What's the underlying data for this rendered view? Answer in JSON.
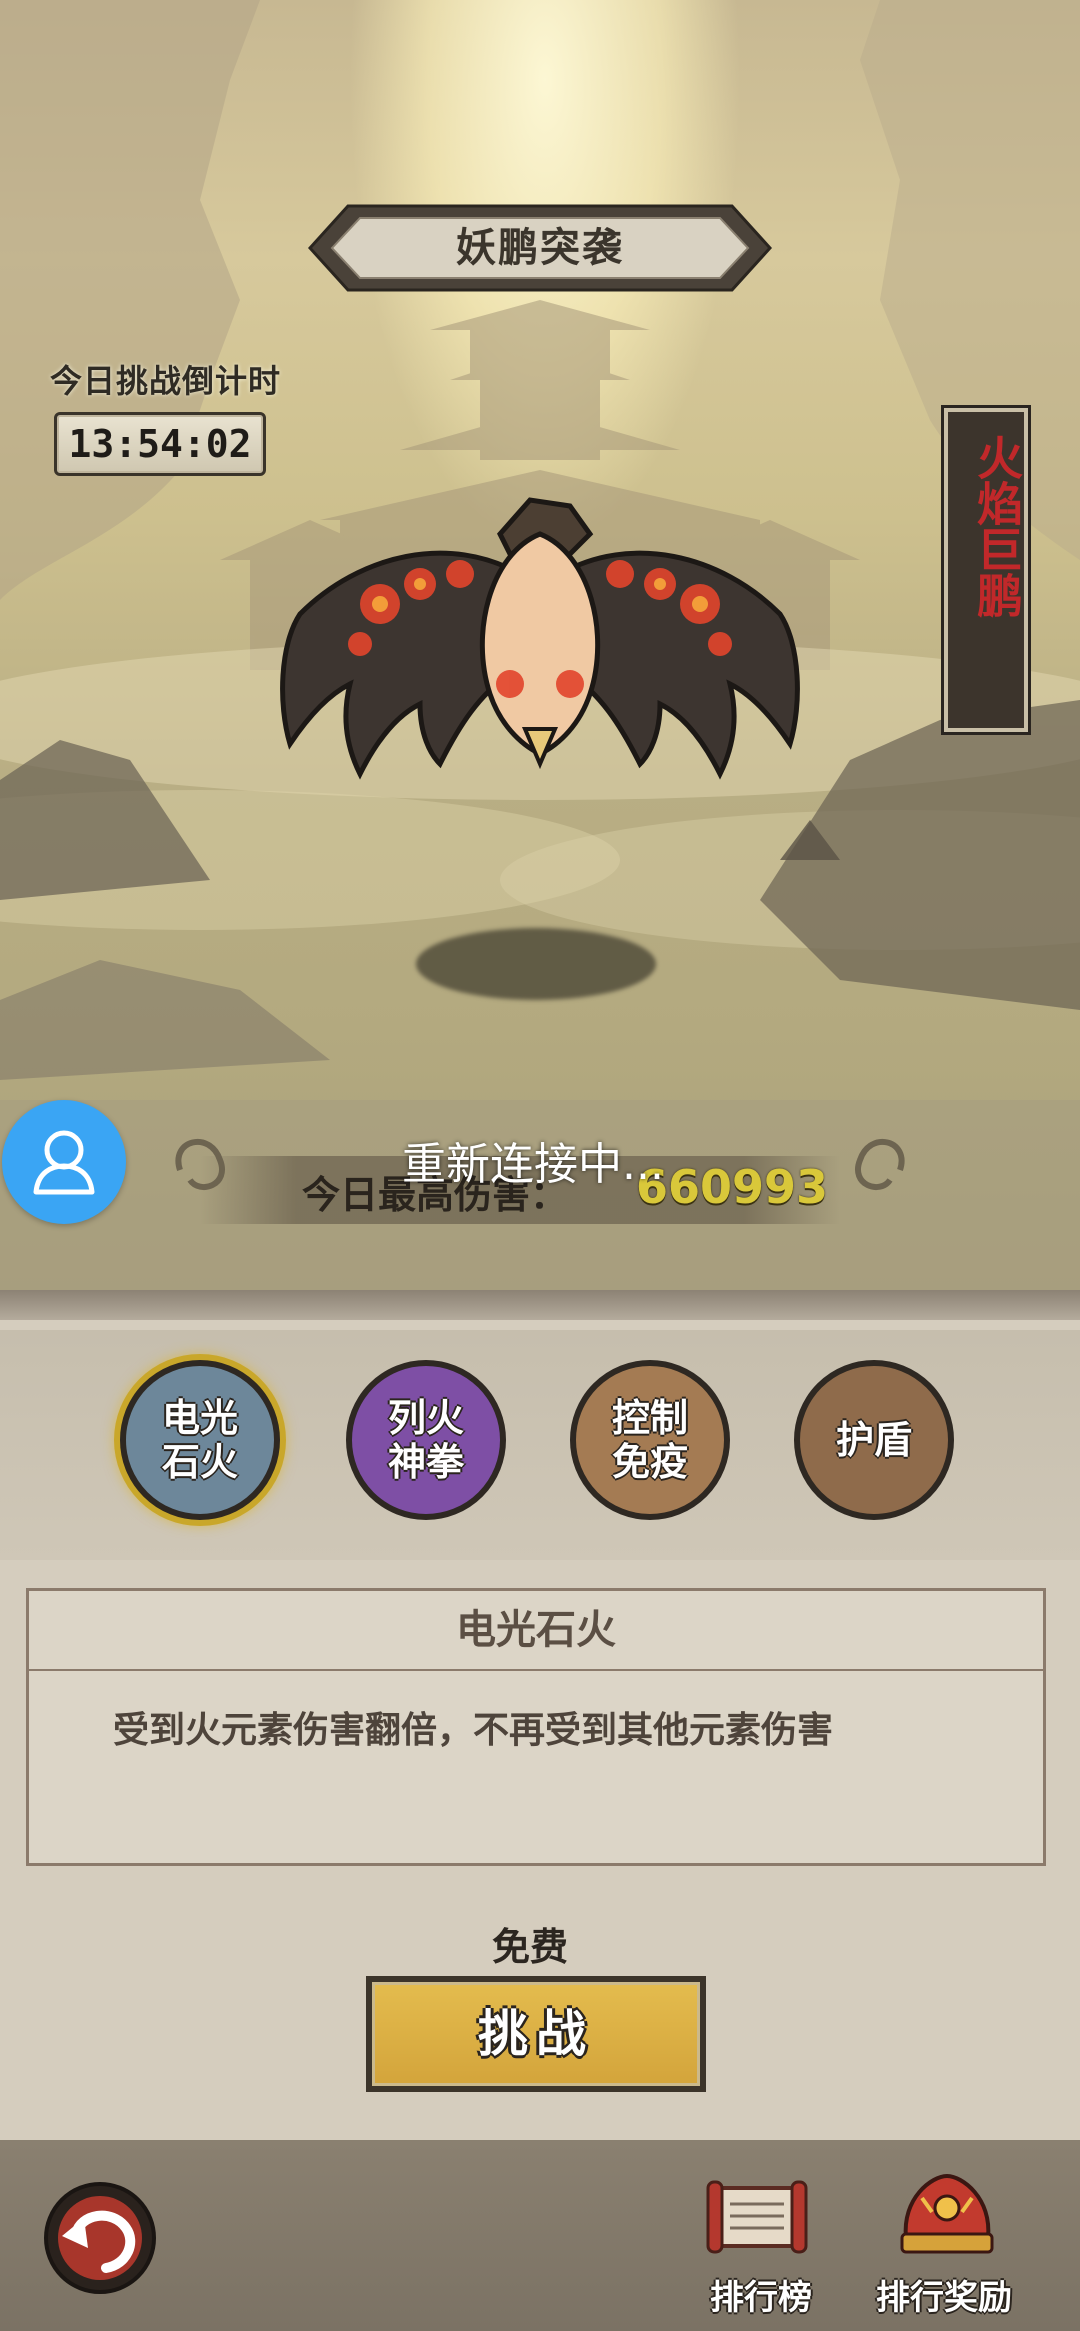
{
  "header": {
    "title": "妖鹏突袭",
    "timer_label": "今日挑战倒计时",
    "timer_value": "13:54:02",
    "boss_name": "火焰巨鹏"
  },
  "battle": {
    "max_damage_label": "今日最高伤害：",
    "max_damage_value": "660993",
    "status_toast": "重新连接中..."
  },
  "skills": [
    {
      "label": "电光\n石火",
      "selected": true,
      "color": "#6d879a"
    },
    {
      "label": "列火\n神拳",
      "selected": false,
      "color": "#7e4fa5"
    },
    {
      "label": "控制\n免疫",
      "selected": false,
      "color": "#a47b53"
    },
    {
      "label": "护盾",
      "selected": false,
      "color": "#8f6b4b"
    }
  ],
  "skill_detail": {
    "title": "电光石火",
    "description": "受到火元素伤害翻倍，不再受到其他元素伤害"
  },
  "challenge": {
    "cost_label": "免费",
    "button_label": "挑战"
  },
  "footer": {
    "ranking_label": "排行榜",
    "ranking_reward_label": "排行奖励"
  },
  "icons": {
    "user": "user-icon",
    "back": "back-arrow-icon",
    "ranking": "scroll-icon",
    "reward": "helmet-icon"
  },
  "colors": {
    "accent_gold": "#e4bc4e",
    "damage_value": "#d9c83a",
    "boss_name": "#c1282a",
    "fab_blue": "#3aa5f4"
  }
}
